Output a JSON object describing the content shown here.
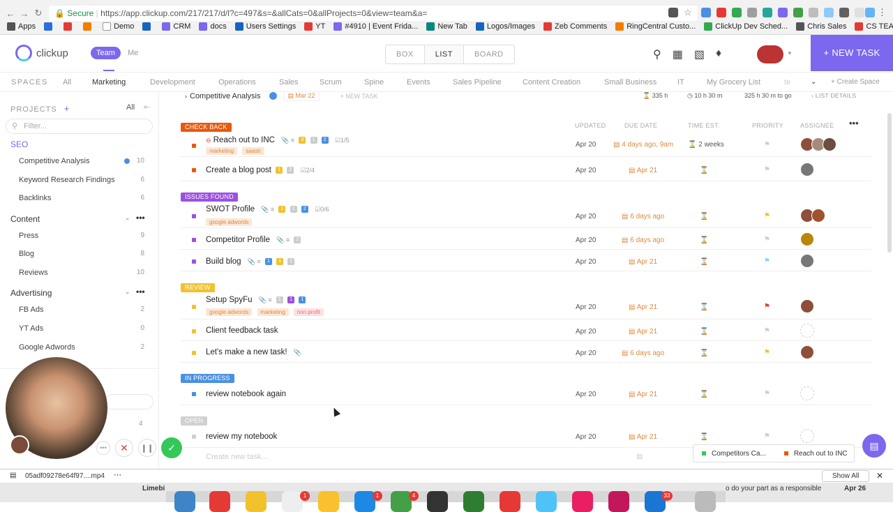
{
  "browser": {
    "secure_label": "Secure",
    "url": "https://app.clickup.com/217/217/d/l?c=497&s=&allCats=0&allProjects=0&view=team&a=",
    "bookmarks": [
      "Apps",
      "Demo",
      "CRM",
      "docs",
      "Users Settings",
      "YT",
      "#4910 | Event Frida...",
      "New Tab",
      "Logos/Images",
      "Zeb Comments",
      "RingCentral Custo...",
      "ClickUp Dev Sched...",
      "Chris Sales",
      "CS TEAM CHECK"
    ]
  },
  "topbar": {
    "logo_text": "clickup",
    "team_label": "Team",
    "me_label": "Me",
    "views": [
      "BOX",
      "LIST",
      "BOARD"
    ],
    "new_task_label": "+ NEW TASK"
  },
  "spaces": {
    "label": "SPACES",
    "items": [
      "All",
      "Marketing",
      "Development",
      "Operations",
      "Sales",
      "Scrum",
      "Spine",
      "Events",
      "Sales Pipeline",
      "Content Creation",
      "Small Business",
      "IT",
      "My Grocery List",
      "te"
    ],
    "create_label": "+ Create Space",
    "active": "Marketing"
  },
  "sidebar": {
    "projects_label": "PROJECTS",
    "all_label": "All",
    "filter_placeholder": "Filter...",
    "folders": [
      {
        "name": "SEO",
        "lists": [
          {
            "name": "Competitive Analysis",
            "count": "10"
          },
          {
            "name": "Keyword Research Findings",
            "count": "6"
          },
          {
            "name": "Backlinks",
            "count": "6"
          }
        ]
      },
      {
        "name": "Content",
        "lists": [
          {
            "name": "Press",
            "count": "9"
          },
          {
            "name": "Blog",
            "count": "8"
          },
          {
            "name": "Reviews",
            "count": "10"
          }
        ]
      },
      {
        "name": "Advertising",
        "lists": [
          {
            "name": "FB Ads",
            "count": "2"
          },
          {
            "name": "YT Ads",
            "count": "0"
          },
          {
            "name": "Google Adwords",
            "count": "2"
          }
        ]
      }
    ],
    "hidden_count": "4"
  },
  "main": {
    "list_title": "Competitive Analysis",
    "list_date": "Mar 22",
    "new_task_inline": "+ NEW TASK",
    "total_time": "335 h",
    "tracked_time": "10 h 30 m",
    "remaining": "325 h 30 m to go",
    "list_details": "LIST DETAILS",
    "columns": [
      "UPDATED",
      "DUE DATE",
      "TIME EST.",
      "PRIORITY",
      "ASSIGNEE"
    ],
    "groups": [
      {
        "status": "CHECK BACK",
        "color": "#e8590c",
        "tasks": [
          {
            "name": "Reach out to INC",
            "updated": "Apr 20",
            "due": "4 days ago, 9am",
            "estimate": "2 weeks",
            "checklist": "1/5",
            "tags": [
              "marketing",
              "saastr"
            ],
            "priority": "none",
            "assignees": 3
          },
          {
            "name": "Create a blog post",
            "updated": "Apr 20",
            "due": "Apr 21",
            "estimate": "",
            "checklist": "2/4",
            "tags": [],
            "priority": "none",
            "assignees": 1
          }
        ]
      },
      {
        "status": "ISSUES FOUND",
        "color": "#9b51e0",
        "tasks": [
          {
            "name": "SWOT Profile",
            "updated": "Apr 20",
            "due": "6 days ago",
            "estimate": "",
            "checklist": "0/6",
            "tags": [
              "google adwords"
            ],
            "priority": "yellow",
            "assignees": 2
          },
          {
            "name": "Competitor Profile",
            "updated": "Apr 20",
            "due": "6 days ago",
            "estimate": "",
            "checklist": "",
            "tags": [],
            "priority": "none",
            "assignees": 1
          },
          {
            "name": "Build blog",
            "updated": "Apr 20",
            "due": "Apr 21",
            "estimate": "",
            "checklist": "",
            "tags": [],
            "priority": "blue",
            "assignees": 1
          }
        ]
      },
      {
        "status": "REVIEW",
        "color": "#f2c12e",
        "tasks": [
          {
            "name": "Setup SpyFu",
            "updated": "Apr 20",
            "due": "Apr 21",
            "estimate": "",
            "checklist": "",
            "tags": [
              "google adwords",
              "marketing",
              "non profit"
            ],
            "priority": "red",
            "assignees": 1
          },
          {
            "name": "Client feedback task",
            "updated": "Apr 20",
            "due": "Apr 21",
            "estimate": "",
            "checklist": "",
            "tags": [],
            "priority": "none",
            "assignees": 0
          },
          {
            "name": "Let's make a new task!",
            "updated": "Apr 20",
            "due": "6 days ago",
            "estimate": "",
            "checklist": "",
            "tags": [],
            "priority": "yellow",
            "assignees": 1
          }
        ]
      },
      {
        "status": "IN PROGRESS",
        "color": "#4a90e2",
        "tasks": [
          {
            "name": "review notebook again",
            "updated": "Apr 20",
            "due": "Apr 21",
            "estimate": "",
            "checklist": "",
            "tags": [],
            "priority": "none",
            "assignees": 0
          }
        ]
      },
      {
        "status": "OPEN",
        "color": "#d0d0d0",
        "tasks": [
          {
            "name": "review my notebook",
            "updated": "Apr 20",
            "due": "Apr 21",
            "estimate": "",
            "checklist": "",
            "tags": [],
            "priority": "none",
            "assignees": 0
          }
        ]
      }
    ],
    "create_placeholder": "Create new task..."
  },
  "tray": {
    "tab1": "Competitors Ca...",
    "tab2": "Reach out to INC"
  },
  "download": {
    "file": "05adf09278e64f97....mp4",
    "show_all": "Show All"
  },
  "dock_badges": [
    "1",
    "1",
    "4",
    "33"
  ],
  "dock_label_1": "Limebi",
  "dock_label_2": "o do your part as a responsible",
  "dock_date": "Apr 26"
}
